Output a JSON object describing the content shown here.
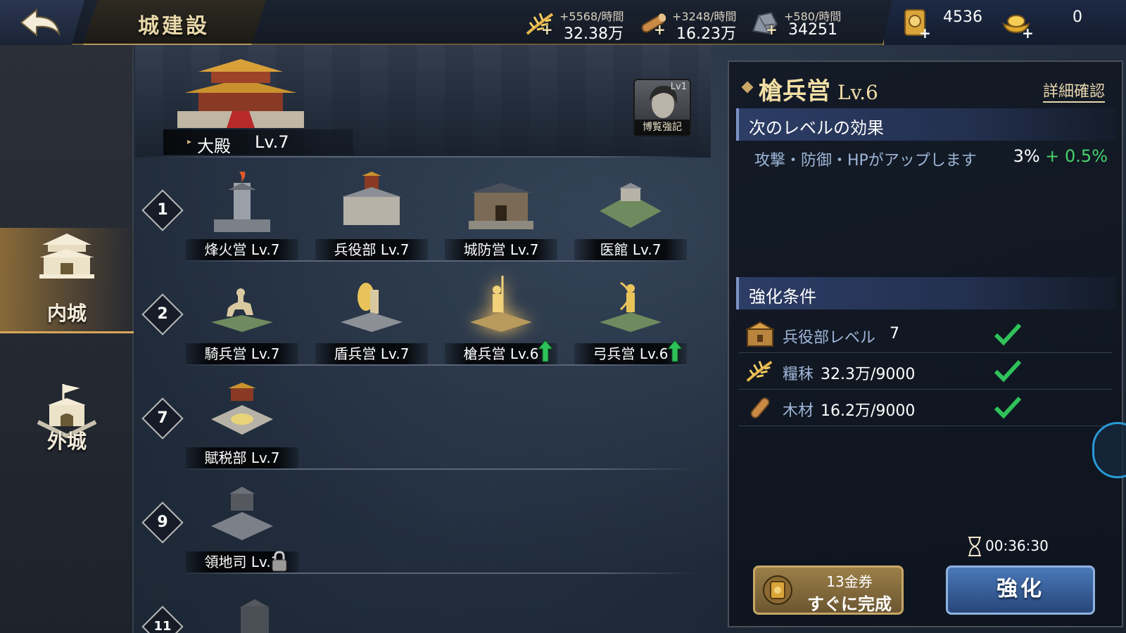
{
  "header": {
    "title": "城建設",
    "resources": [
      {
        "name": "grain",
        "icon": "grain-icon",
        "rate": "+5568/時間",
        "amount": "32.38万"
      },
      {
        "name": "wood",
        "icon": "wood-icon",
        "rate": "+3248/時間",
        "amount": "16.23万"
      },
      {
        "name": "stone",
        "icon": "stone-icon",
        "rate": "+580/時間",
        "amount": "34251"
      }
    ],
    "gold_ticket": "4536",
    "gold_ingot": "0"
  },
  "sidebar": {
    "items": [
      {
        "label": "内城",
        "active": true
      },
      {
        "label": "外城",
        "active": false
      }
    ]
  },
  "palace": {
    "name": "大殿",
    "level": "Lv.7"
  },
  "bonus_card": {
    "level": "Lv1",
    "label": "博覧強記"
  },
  "rows": [
    {
      "num": "1",
      "buildings": [
        {
          "label": "烽火営 Lv.7"
        },
        {
          "label": "兵役部 Lv.7"
        },
        {
          "label": "城防営 Lv.7"
        },
        {
          "label": "医館 Lv.7"
        }
      ]
    },
    {
      "num": "2",
      "buildings": [
        {
          "label": "騎兵営 Lv.7"
        },
        {
          "label": "盾兵営 Lv.7"
        },
        {
          "label": "槍兵営 Lv.6",
          "upgradable": true,
          "selected": true
        },
        {
          "label": "弓兵営 Lv.6",
          "upgradable": true
        }
      ]
    },
    {
      "num": "7",
      "buildings": [
        {
          "label": "賦税部 Lv.7"
        }
      ]
    },
    {
      "num": "9",
      "buildings": [
        {
          "label": "領地司 Lv.1",
          "locked": true
        }
      ]
    },
    {
      "num": "11",
      "buildings": []
    }
  ],
  "panel": {
    "title": "槍兵営",
    "level": "Lv.6",
    "detail_link": "詳細確認",
    "effect_header": "次のレベルの効果",
    "effect_text": "攻撃・防御・HPがアップします",
    "effect_base": "3%",
    "effect_inc": "+ 0.5%",
    "cond_header": "強化条件",
    "conditions": [
      {
        "name": "兵役部レベル",
        "value": "7",
        "met": true
      },
      {
        "name": "糧秣",
        "value": "32.3万/9000",
        "met": true
      },
      {
        "name": "木材",
        "value": "16.2万/9000",
        "met": true
      }
    ],
    "timer": "00:36:30",
    "instant_cost": "13金券",
    "instant_label": "すぐに完成",
    "enhance_label": "強化"
  },
  "colors": {
    "accent_gold": "#f3dfa5",
    "positive": "#47d36b",
    "effect_blue": "#9fb6d8"
  }
}
